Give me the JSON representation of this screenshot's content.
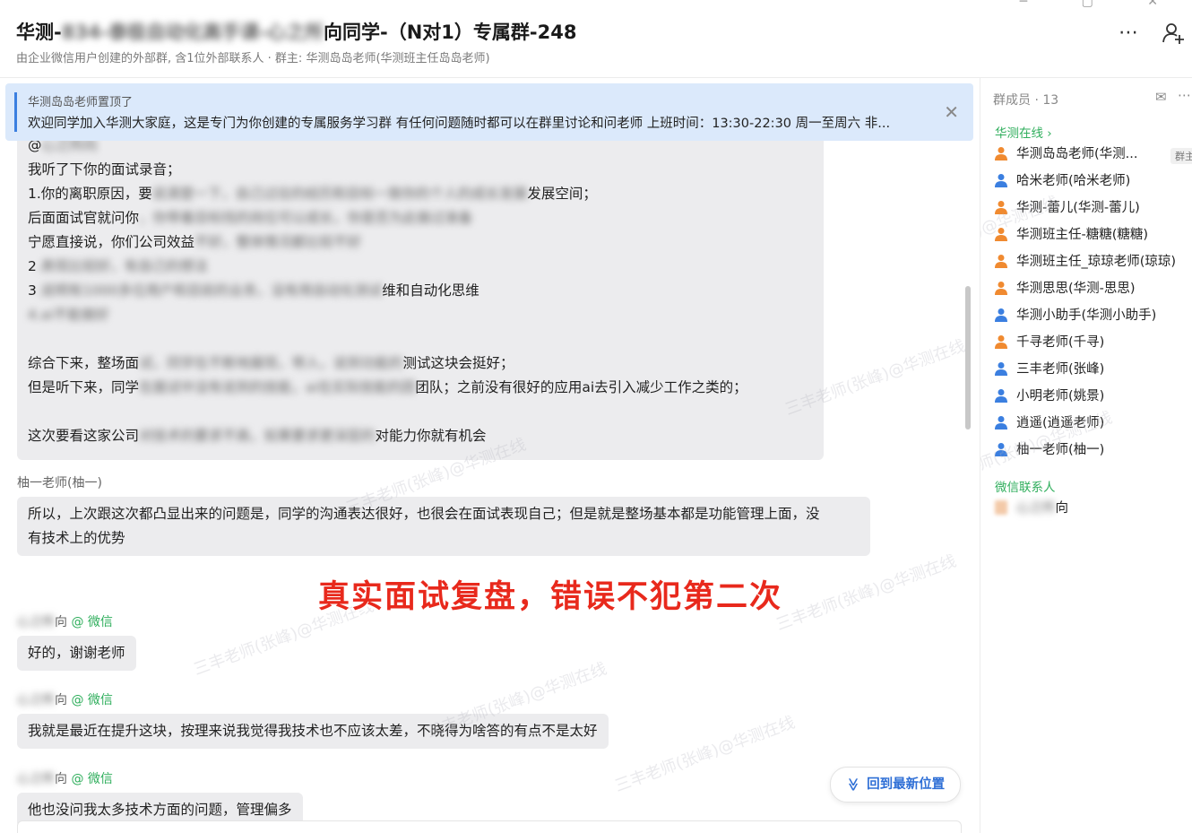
{
  "header": {
    "title_prefix": "华测-",
    "title_hidden": "834-泰极自动化高手课-心之所",
    "title_suffix": "向同学-（N对1）专属群-248",
    "subtitle": "由企业微信用户创建的外部群, 含1位外部联系人 · 群主: 华测岛岛老师(华测班主任岛岛老师)",
    "icon_more": "⋯",
    "icon_add": "⚲+"
  },
  "pinned": {
    "who": "华测岛岛老师置顶了",
    "text": "欢迎同学加入华测大家庭，这是专门为你创建的专属服务学习群 有任何问题随时都可以在群里讨论和问老师   上班时间：13:30-22:30    周一至周六 非...",
    "close": "✕"
  },
  "bubble1": {
    "lines": [
      {
        "a": "@",
        "h": "心之所向",
        "b": ""
      },
      {
        "a": "我听了下你的面试录音；",
        "h": "",
        "b": ""
      },
      {
        "a": "1.你的离职原因，要",
        "h": "说清楚一下，自己过往的经历和目标一致你的个人的成长发展",
        "b": "发展空间；"
      },
      {
        "a": "后面面试官就问你",
        "h": "，你带着目标找的岗位可以成长，你是否为此做过准备",
        "b": ""
      },
      {
        "a": "宁愿直接说，你们公司效益",
        "h": "不好，整体情况都比较不好",
        "b": ""
      },
      {
        "a": "2",
        "h": ".表现比较好，有自己的想法",
        "b": ""
      },
      {
        "a": "3",
        "h": ".说明有1000多位用户和目前的业务，没有用自动化测试",
        "b": "维和自动化思维"
      },
      {
        "a": "",
        "h": "4.ai不能做好",
        "b": ""
      },
      {
        "a": "",
        "h": "",
        "b": ""
      },
      {
        "a": "综合下来，整场面",
        "h": "试，同学在不断地展现，带入，说到功能的",
        "b": "测试这块会挺好；"
      },
      {
        "a": "但是听下来，同学",
        "h": "在面试中没有说到的技能，ai在实际技能的团",
        "b": "团队；之前没有很好的应用ai去引入减少工作之类的；"
      },
      {
        "a": "",
        "h": "",
        "b": ""
      },
      {
        "a": "这次要看这家公司",
        "h": "对技术的要求不高，如果要求更深层的",
        "b": "对能力你就有机会"
      }
    ]
  },
  "msg2": {
    "sender": "柚一老师(柚一)",
    "lines": [
      "所以，上次跟这次都凸显出来的问题是，同学的沟通表达很好，也很会在面试表现自己；但是就是整场基本都是功能管理上面，没",
      "有技术上的优势"
    ]
  },
  "banner": "真实面试复盘，错误不犯第二次",
  "msg3": {
    "sender_hidden": "心之所",
    "sender_suffix": "向",
    "wechat": "@ 微信",
    "text": "好的，谢谢老师"
  },
  "msg4": {
    "sender_hidden": "心之所",
    "sender_suffix": "向",
    "wechat": "@ 微信",
    "text": "我就是最近在提升这块，按理来说我觉得我技术也不应该太差，不晓得为啥答的有点不是太好"
  },
  "msg5": {
    "sender_hidden": "心之所",
    "sender_suffix": "向",
    "wechat": "@ 微信",
    "text": "他也没问我太多技术方面的问题，管理偏多"
  },
  "back_button": "回到最新位置",
  "back_icon": "≫",
  "watermark": "三丰老师(张峰)@华测在线",
  "sidebar": {
    "count": "群成员 · 13",
    "mail_icon": "✉",
    "more_icon": "⋯",
    "group_huace": "华测在线 ›",
    "group_wechat": "微信联系人",
    "owner_tag": "群主",
    "members": [
      {
        "name": "华测岛岛老师(华测...",
        "color": "#f08a30"
      },
      {
        "name": "哈米老师(哈米老师)",
        "color": "#3b7fe0"
      },
      {
        "name": "华测-蕾儿(华测-蕾儿)",
        "color": "#f08a30"
      },
      {
        "name": "华测班主任-糖糖(糖糖)",
        "color": "#f08a30"
      },
      {
        "name": "华测班主任_琼琼老师(琼琼)",
        "color": "#f08a30"
      },
      {
        "name": "华测思思(华测-思思)",
        "color": "#f08a30"
      },
      {
        "name": "华测小助手(华测小助手)",
        "color": "#3b7fe0"
      },
      {
        "name": "千寻老师(千寻)",
        "color": "#f08a30"
      },
      {
        "name": "三丰老师(张峰)",
        "color": "#3b7fe0"
      },
      {
        "name": "小明老师(姚景)",
        "color": "#3b7fe0"
      },
      {
        "name": "逍遥(逍遥老师)",
        "color": "#3b7fe0"
      },
      {
        "name": "柚一老师(柚一)",
        "color": "#3b7fe0"
      }
    ],
    "wechat_member_hidden": "心之所",
    "wechat_member_suffix": "向"
  }
}
